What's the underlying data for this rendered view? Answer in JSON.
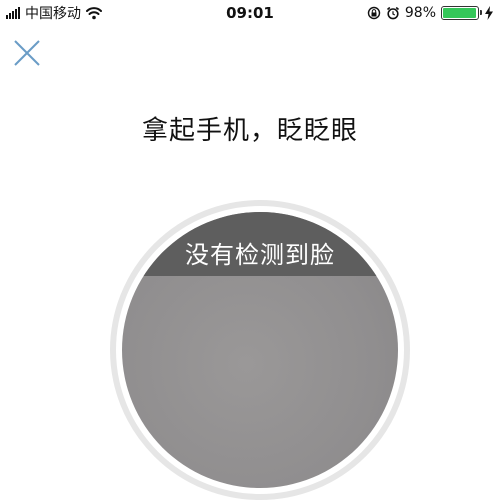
{
  "status_bar": {
    "carrier": "中国移动",
    "time": "09:01",
    "battery_percent": "98%",
    "battery_level": 0.98,
    "icons": [
      "signal-icon",
      "wifi-icon",
      "orientation-lock-icon",
      "alarm-icon",
      "battery-icon",
      "charging-icon"
    ]
  },
  "header": {
    "close_icon": "close-icon"
  },
  "main": {
    "title": "拿起手机，眨眨眼",
    "scan_message": "没有检测到脸"
  },
  "colors": {
    "accent": "#6a9cc6",
    "battery": "#34c759",
    "banner": "#5e5e5e"
  }
}
